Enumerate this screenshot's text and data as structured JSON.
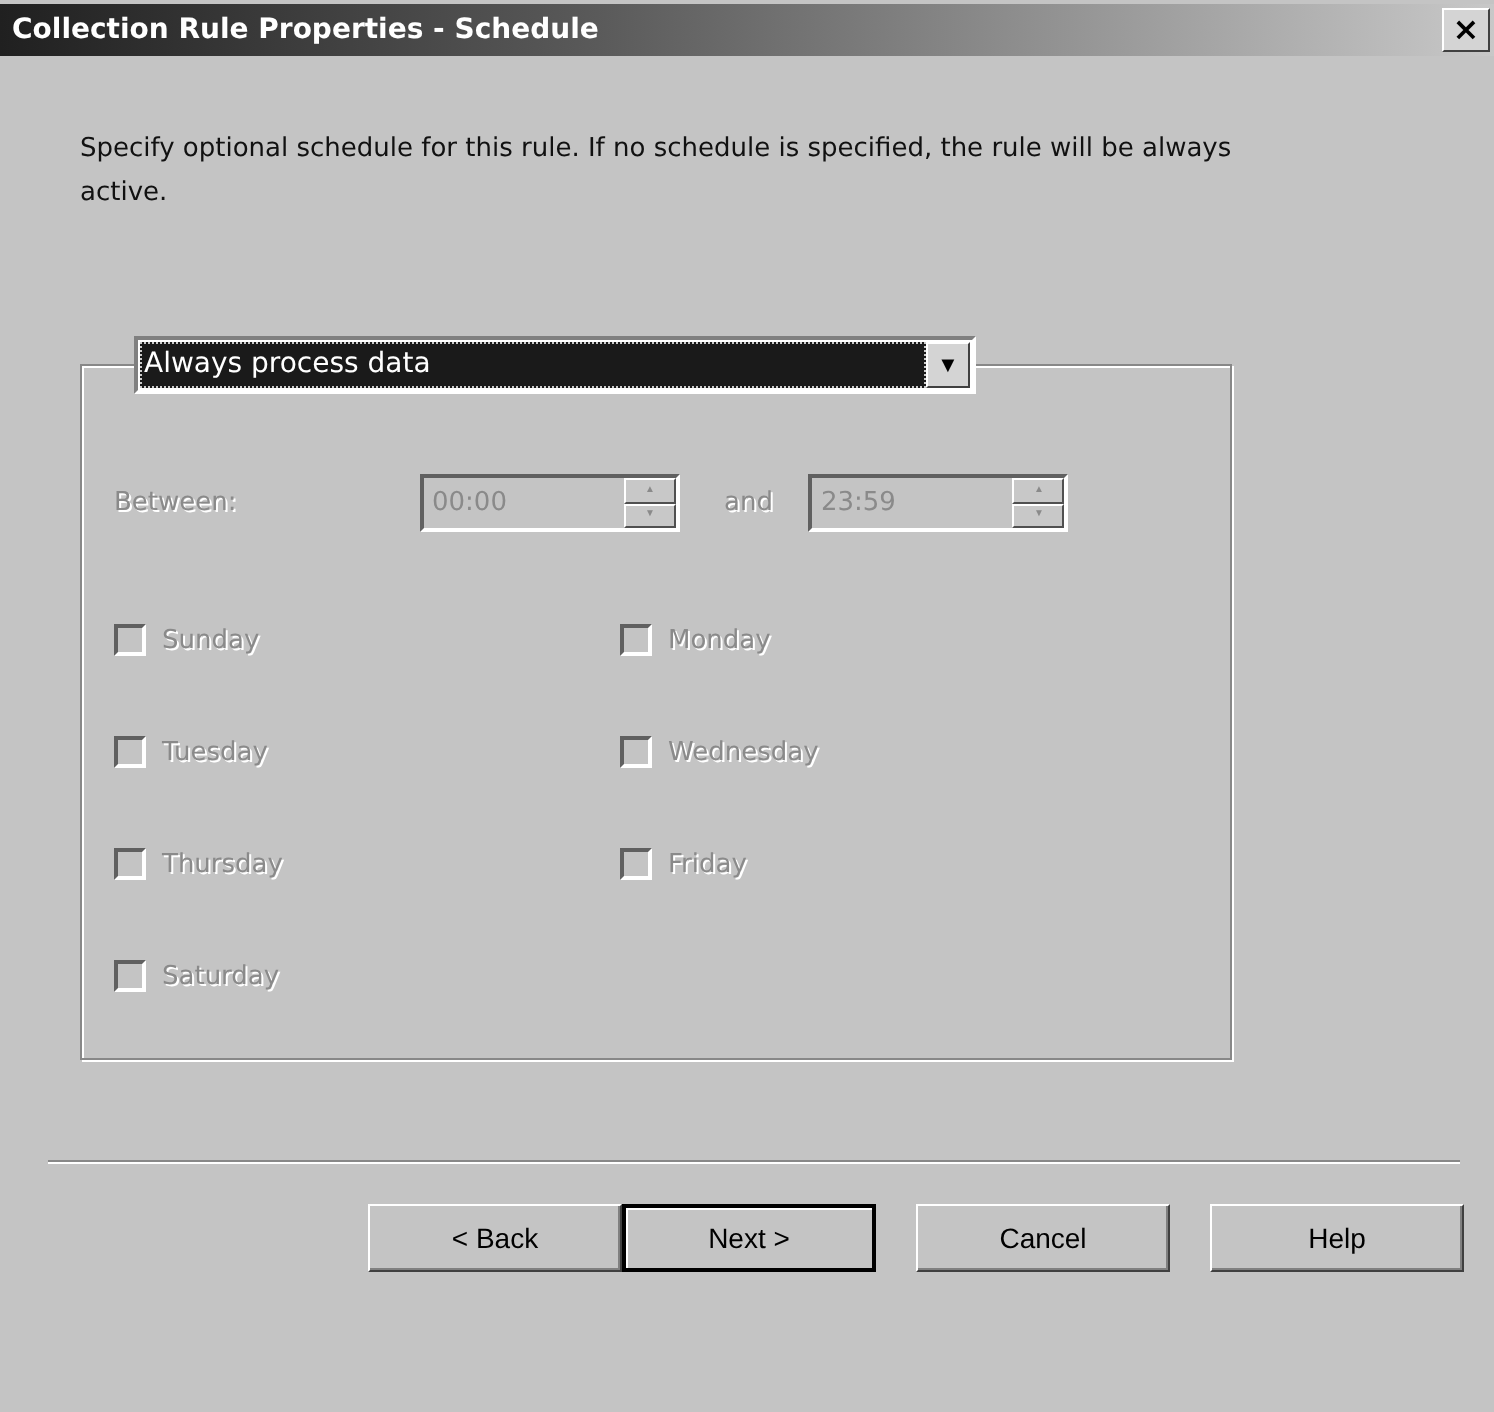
{
  "window": {
    "title": "Collection Rule Properties - Schedule",
    "close": "×"
  },
  "description": "Specify optional schedule for this rule. If no schedule is specified, the rule will be always active.",
  "schedule_mode": {
    "value": "Always process data",
    "focused": true,
    "arrow": "▼"
  },
  "time_range": {
    "label": "Between:",
    "joiner": "and",
    "disabled": true,
    "from": "00:00",
    "to": "23:59",
    "up": "▲",
    "down": "▼"
  },
  "days": [
    {
      "label": "Sunday",
      "checked": false,
      "disabled": true
    },
    {
      "label": "Monday",
      "checked": false,
      "disabled": true
    },
    {
      "label": "Tuesday",
      "checked": false,
      "disabled": true
    },
    {
      "label": "Wednesday",
      "checked": false,
      "disabled": true
    },
    {
      "label": "Thursday",
      "checked": false,
      "disabled": true
    },
    {
      "label": "Friday",
      "checked": false,
      "disabled": true
    },
    {
      "label": "Saturday",
      "checked": false,
      "disabled": true
    }
  ],
  "buttons": [
    {
      "label": "< Back",
      "default": false
    },
    {
      "label": "Next >",
      "default": true
    },
    {
      "label": "Cancel",
      "default": false
    },
    {
      "label": "Help",
      "default": false
    }
  ]
}
